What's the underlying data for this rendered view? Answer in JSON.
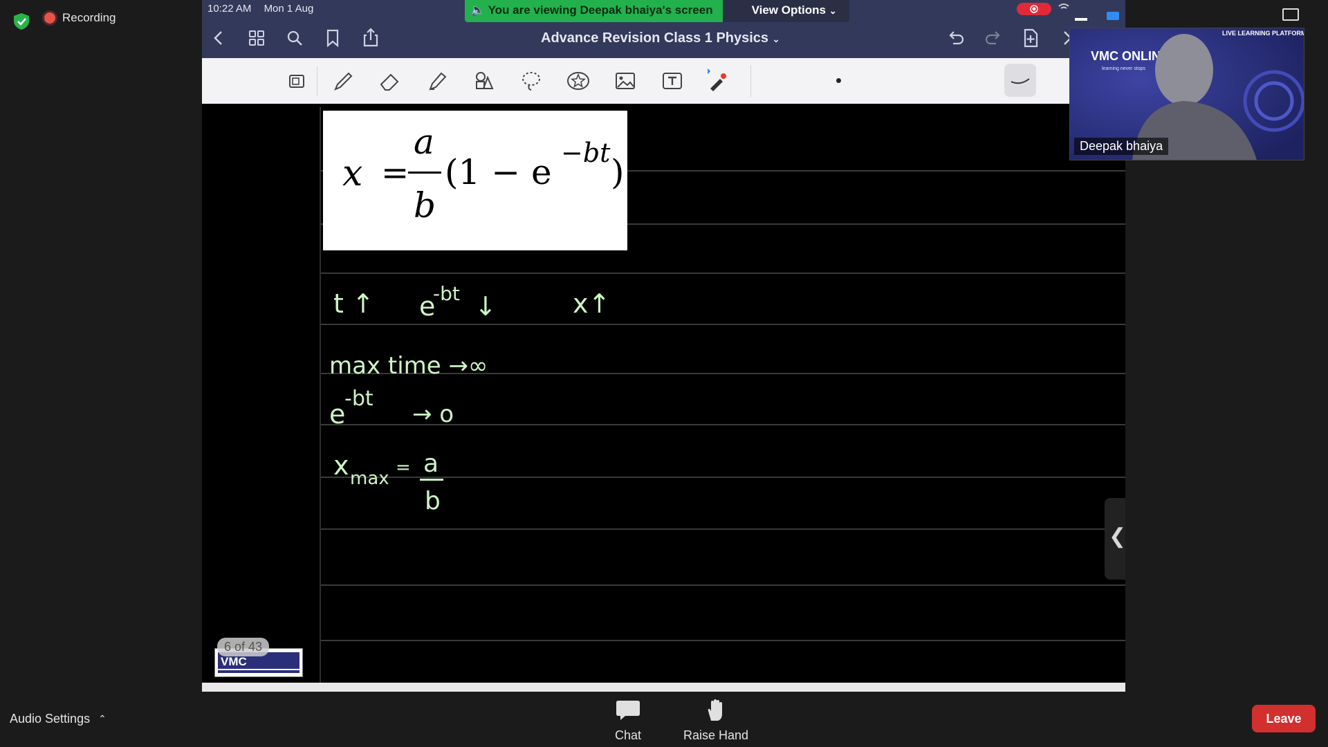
{
  "meeting": {
    "recording_label": "Recording",
    "audio_settings_label": "Audio Settings",
    "chat_label": "Chat",
    "raise_hand_label": "Raise Hand",
    "leave_label": "Leave",
    "share_banner": "You are viewing Deepak bhaiya's screen",
    "view_options_label": "View Options"
  },
  "participant": {
    "name": "Deepak bhaiya",
    "bg_brand": "VMC ONLINE",
    "bg_tagline": "learning never stops",
    "bg_header": "LIVE LEARNING PLATFORM"
  },
  "ipad": {
    "time": "10:22 AM",
    "date": "Mon 1 Aug",
    "document_title": "Advance Revision Class 1 Physics",
    "page_indicator": "6 of 43",
    "logo_text": "VMC"
  },
  "notes": {
    "formula": {
      "lhs": "x",
      "numerator": "a",
      "denominator": "b",
      "bracket_open": "(1 − e",
      "exponent": "−bt",
      "bracket_close": ")"
    },
    "line1": {
      "t": "t ↑",
      "e_base": "e",
      "e_exp": "-bt",
      "e_arrow": "↓",
      "x": "x↑"
    },
    "line2": "max  time  →∞",
    "line3": {
      "base": "e",
      "exp": "-bt",
      "arrow": "→ o"
    },
    "line4": {
      "x": "x",
      "sub": "max",
      "eq": "=",
      "num": "a",
      "den": "b"
    }
  },
  "colors": {
    "accent_green": "#23b14d",
    "ink_green": "#cdf5c4",
    "leave_red": "#d22f2f",
    "ipad_bar": "#33395a"
  },
  "icons": [
    "shield-check-icon",
    "back-icon",
    "grid-icon",
    "search-icon",
    "bookmark-icon",
    "share-icon",
    "undo-icon",
    "redo-icon",
    "add-page-icon",
    "page-icon",
    "pen-icon",
    "eraser-icon",
    "highlighter-icon",
    "shapes-icon",
    "lasso-icon",
    "sticker-icon",
    "image-icon",
    "textbox-icon",
    "laser-icon",
    "chat-icon",
    "hand-icon"
  ]
}
